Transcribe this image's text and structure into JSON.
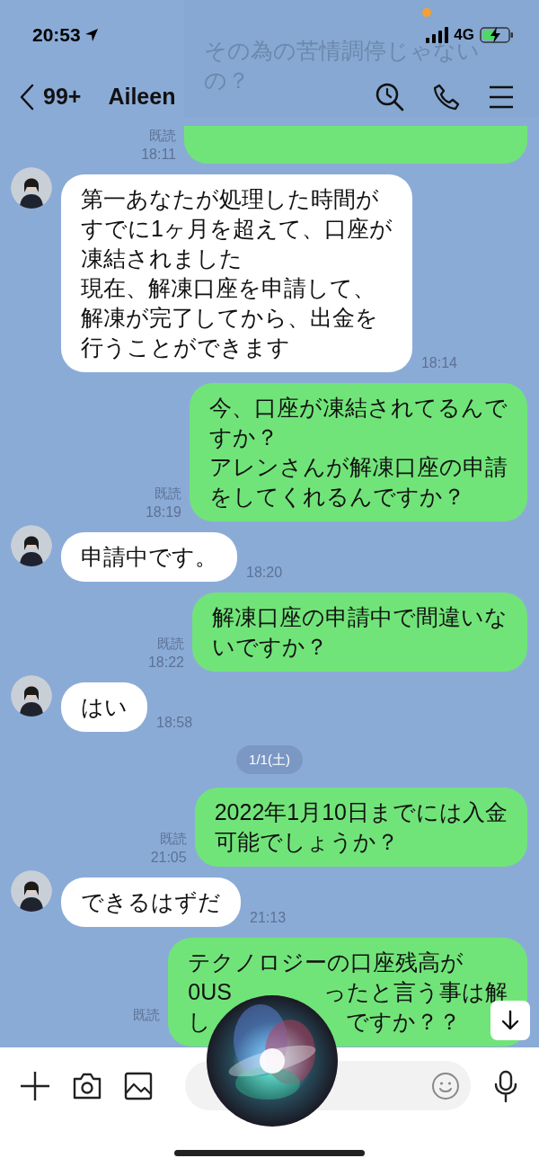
{
  "status_bar": {
    "time": "20:53",
    "network": "4G"
  },
  "overlay_preview": {
    "lines": [
      "その為の苦情調停じゃない",
      "の？"
    ]
  },
  "header": {
    "back_count": "99+",
    "title": "Aileen"
  },
  "messages": [
    {
      "kind": "outgoing",
      "read": "既読",
      "time": "18:11"
    },
    {
      "kind": "incoming",
      "lines": [
        "第一あなたが処理した時間が",
        "すでに1ヶ月を超えて、口座が",
        "凍結されました",
        "現在、解凍口座を申請して、",
        "解凍が完了してから、出金を",
        "行うことができます"
      ],
      "time": "18:14"
    },
    {
      "kind": "outgoing",
      "read": "既読",
      "time": "18:19",
      "lines": [
        "今、口座が凍結されてるんで",
        "すか？",
        "アレンさんが解凍口座の申請",
        "をしてくれるんですか？"
      ]
    },
    {
      "kind": "incoming",
      "lines": [
        "申請中です。"
      ],
      "time": "18:20"
    },
    {
      "kind": "outgoing",
      "read": "既読",
      "time": "18:22",
      "lines": [
        "解凍口座の申請中で間違いな",
        "いですか？"
      ]
    },
    {
      "kind": "incoming",
      "lines": [
        "はい"
      ],
      "time": "18:58"
    },
    {
      "kind": "date",
      "label": "1/1(土)"
    },
    {
      "kind": "outgoing",
      "read": "既読",
      "time": "21:05",
      "lines": [
        "2022年1月10日までには入金",
        "可能でしょうか？"
      ]
    },
    {
      "kind": "incoming",
      "lines": [
        "できるはずだ"
      ],
      "time": "21:13"
    },
    {
      "kind": "outgoing",
      "read": "既読",
      "lines": [
        "テクノロジーの口座残高が",
        [
          "0US",
          "ったと言う事は解"
        ],
        [
          "し",
          "ですか？？"
        ]
      ]
    }
  ]
}
